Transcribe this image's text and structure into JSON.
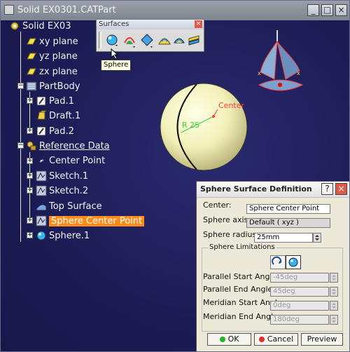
{
  "window": {
    "title": "Solid EX0301.CATPart",
    "buttons": {
      "minimize": "_",
      "maximize": "□",
      "close": "×"
    }
  },
  "tree": {
    "root": "Solid EX03",
    "items": [
      {
        "label": "xy plane",
        "icon": "plane-icon"
      },
      {
        "label": "yz plane",
        "icon": "plane-icon"
      },
      {
        "label": "zx plane",
        "icon": "plane-icon"
      },
      {
        "label": "PartBody",
        "icon": "partbody-icon"
      },
      {
        "label": "Pad.1",
        "icon": "pad-icon"
      },
      {
        "label": "Draft.1",
        "icon": "draft-icon"
      },
      {
        "label": "Pad.2",
        "icon": "pad-icon"
      },
      {
        "label": "Reference Data",
        "icon": "geometrical-set-icon"
      },
      {
        "label": "Center Point",
        "icon": "point-icon"
      },
      {
        "label": "Sketch.1",
        "icon": "sketch-icon"
      },
      {
        "label": "Sketch.2",
        "icon": "sketch-icon"
      },
      {
        "label": "Top Surface",
        "icon": "surface-icon"
      },
      {
        "label": "Sphere Center Point",
        "icon": "point-icon"
      },
      {
        "label": "Sphere.1",
        "icon": "sphere-icon"
      }
    ]
  },
  "toolbar": {
    "title": "Surfaces",
    "close": "×",
    "tooltip": "Sphere"
  },
  "viewport": {
    "center_label": "Center",
    "radius_label": "R 25"
  },
  "dialog": {
    "title": "Sphere Surface Definition",
    "help": "?",
    "close": "×",
    "center_label": "Center:",
    "center_value": "Sphere Center Point",
    "axis_label": "Sphere axis:",
    "axis_value": "Default ( xyz )",
    "radius_label": "Sphere radius:",
    "radius_value": "25mm",
    "limits_title": "Sphere Limitations",
    "parallel_start_label": "Parallel Start Angle:",
    "parallel_start_value": "-45deg",
    "parallel_end_label": "Parallel End Angle:",
    "parallel_end_value": "45deg",
    "meridian_start_label": "Meridian Start Angle:",
    "meridian_start_value": "0deg",
    "meridian_end_label": "Meridian End Angle:",
    "meridian_end_value": "180deg",
    "ok": "OK",
    "cancel": "Cancel",
    "preview": "Preview"
  },
  "colors": {
    "background": "#1f1f5a",
    "selection": "#ff8c1a",
    "sphere": "#f2f0b8",
    "annotation": "#ff3a3a",
    "dimension": "#3ad13a"
  }
}
